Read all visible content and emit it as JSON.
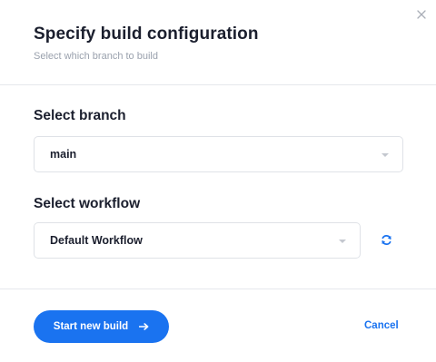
{
  "dialog": {
    "title": "Specify build configuration",
    "subtitle": "Select which branch to build"
  },
  "branch": {
    "label": "Select branch",
    "value": "main"
  },
  "workflow": {
    "label": "Select workflow",
    "value": "Default Workflow"
  },
  "footer": {
    "primary_label": "Start new build",
    "cancel_label": "Cancel"
  },
  "icons": {
    "close": "close-icon",
    "caret": "chevron-down-icon",
    "refresh": "refresh-icon",
    "arrow": "arrow-right-icon"
  },
  "colors": {
    "accent": "#1a73f0",
    "title_text": "#1b1f2e",
    "muted_text": "#9aa1ad",
    "border": "#dfe2e7"
  }
}
